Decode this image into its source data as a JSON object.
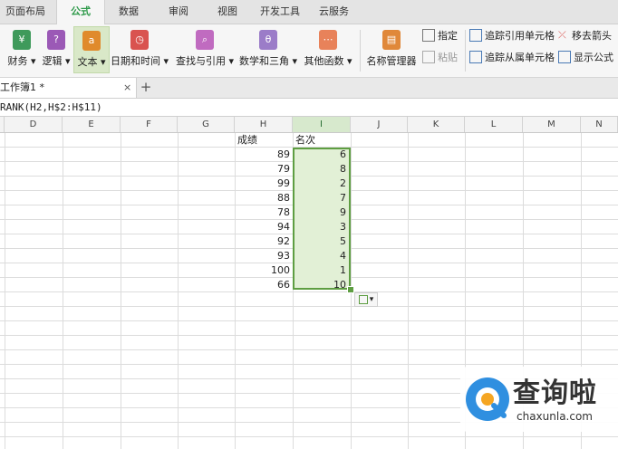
{
  "menu_tabs": [
    {
      "label": "页面布局"
    },
    {
      "label": "公式",
      "active": true
    },
    {
      "label": "数据"
    },
    {
      "label": "审阅"
    },
    {
      "label": "视图"
    },
    {
      "label": "开发工具"
    },
    {
      "label": "云服务"
    }
  ],
  "ribbon": {
    "buttons": [
      {
        "label": "财务 ▾",
        "icon": "finance-icon",
        "color": "#3f9a5b"
      },
      {
        "label": "逻辑 ▾",
        "icon": "logic-icon",
        "color": "#9b59b6"
      },
      {
        "label": "文本 ▾",
        "icon": "text-icon",
        "color": "#e08a2c",
        "selected": true
      },
      {
        "label": "日期和时间 ▾",
        "icon": "clock-icon",
        "color": "#d9534f"
      },
      {
        "label": "查找与引用 ▾",
        "icon": "search-icon",
        "color": "#c06bc0"
      },
      {
        "label": "数学和三角 ▾",
        "icon": "math-icon",
        "color": "#9b7cc8"
      },
      {
        "label": "其他函数 ▾",
        "icon": "more-functions-icon",
        "color": "#e8825a"
      }
    ],
    "name_manager": "名称管理器",
    "specify": "指定",
    "paste": "粘贴",
    "trace_precedents": "追踪引用单元格",
    "trace_dependents": "追踪从属单元格",
    "remove_arrows": "移去箭头",
    "show_formulas": "显示公式"
  },
  "document_tab": {
    "label": "工作簿1 *",
    "close": "×",
    "add": "+"
  },
  "formula_bar": {
    "text": "RANK(H2,H$2:H$11)"
  },
  "columns": [
    "D",
    "E",
    "F",
    "G",
    "H",
    "I",
    "J",
    "K",
    "L",
    "M",
    "N"
  ],
  "active_column": "I",
  "sheet": {
    "header_h": "成绩",
    "header_i": "名次",
    "scores": [
      89,
      79,
      99,
      88,
      78,
      94,
      92,
      93,
      100,
      66
    ],
    "ranks": [
      6,
      8,
      2,
      7,
      9,
      3,
      5,
      4,
      1,
      10
    ]
  },
  "paste_options": {
    "label": "▾"
  },
  "watermark": {
    "brand": "查询啦",
    "domain": "chaxunla.com"
  }
}
